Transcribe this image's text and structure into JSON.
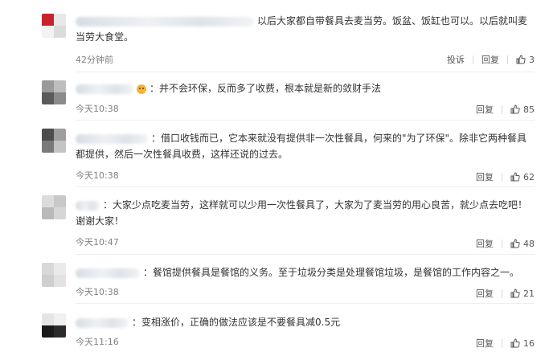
{
  "comments": [
    {
      "text": "以后大家都自带餐具去麦当劳。饭盆、饭缸也可以。以后就叫麦当劳大食堂。",
      "time": "42分钟前",
      "report": "投诉",
      "reply": "回复",
      "likes": "3"
    },
    {
      "text": "：并不会环保，反而多了收费，根本就是新的敛财手法",
      "time": "今天10:38",
      "reply": "回复",
      "likes": "85"
    },
    {
      "text": "：借口收钱而已，它本来就没有提供非一次性餐具，何来的\"为了环保\"。除非它两种餐具都提供，然后一次性餐具收费，这样还说的过去。",
      "time": "今天10:38",
      "reply": "回复",
      "likes": "62"
    },
    {
      "text": "：大家少点吃麦当劳，这样就可以少用一次性餐具了，大家为了麦当劳的用心良苦，就少点去吃吧！谢谢大家！",
      "time": "今天10:47",
      "reply": "回复",
      "likes": "48"
    },
    {
      "text": "：餐馆提供餐具是餐馆的义务。至于垃圾分类是处理餐馆垃圾，是餐馆的工作内容之一。",
      "time": "今天10:38",
      "reply": "回复",
      "likes": "21"
    },
    {
      "text": "：变相涨价，正确的做法应该是不要餐具减0.5元",
      "time": "今天11:16",
      "reply": "回复",
      "likes": "16"
    }
  ],
  "colors": {
    "text": "#333333",
    "time": "#808080",
    "divider": "#eeeeee"
  },
  "icons": {
    "like": "thumbs-up-icon"
  }
}
